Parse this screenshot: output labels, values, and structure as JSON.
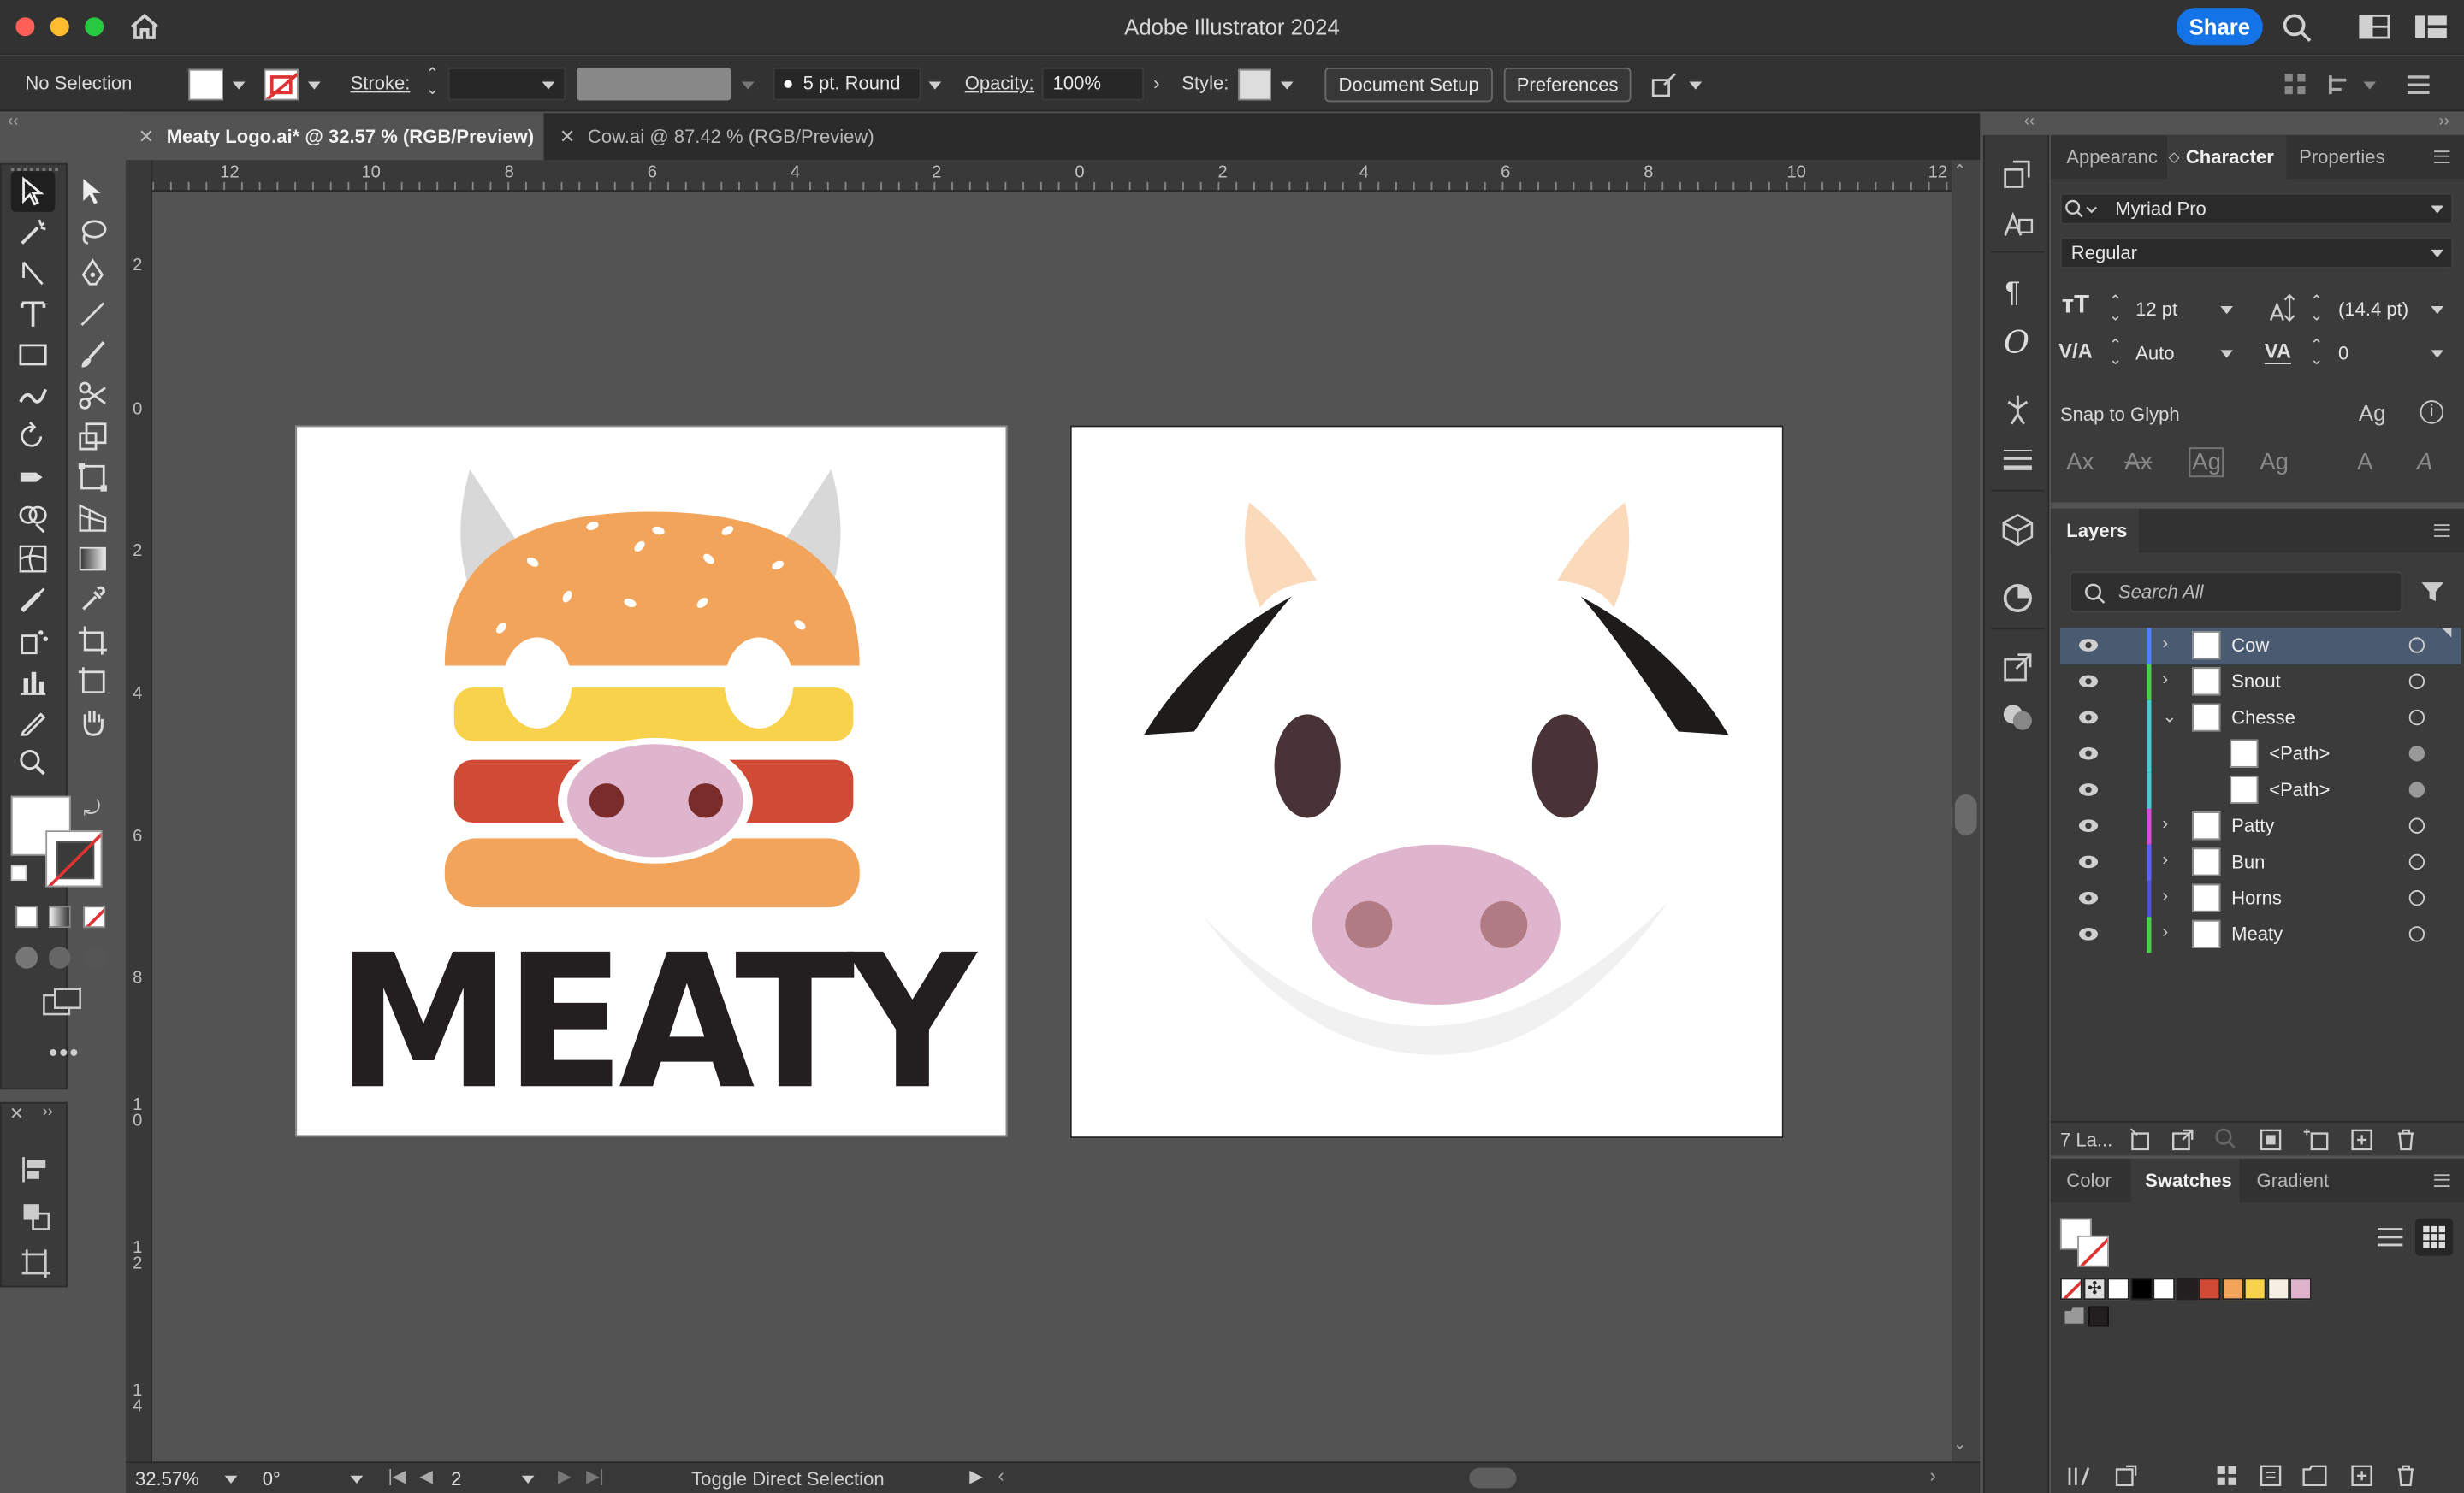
{
  "window": {
    "title": "Adobe Illustrator 2024",
    "share_label": "Share"
  },
  "control_bar": {
    "selection_status": "No Selection",
    "stroke_label": "Stroke:",
    "brush_label": "5 pt. Round",
    "opacity_label": "Opacity:",
    "opacity_value": "100%",
    "style_label": "Style:",
    "document_setup_label": "Document Setup",
    "preferences_label": "Preferences"
  },
  "documents": {
    "tabs": [
      {
        "label": "Meaty Logo.ai* @ 32.57 % (RGB/Preview)",
        "active": true
      },
      {
        "label": "Cow.ai @ 87.42 % (RGB/Preview)",
        "active": false
      }
    ]
  },
  "rulers": {
    "horizontal": [
      "12",
      "10",
      "8",
      "6",
      "4",
      "2",
      "0",
      "2",
      "4",
      "6",
      "8",
      "10",
      "12"
    ],
    "vertical": [
      "2",
      "0",
      "2",
      "4",
      "6",
      "8",
      "10",
      "12",
      "14"
    ]
  },
  "artwork": {
    "logo_text": "MEATY"
  },
  "status_bar": {
    "zoom": "32.57%",
    "rotation": "0°",
    "artboard_number": "2",
    "status_text": "Toggle Direct Selection"
  },
  "character_panel": {
    "tabs": [
      "Appearanc",
      "Character",
      "Properties"
    ],
    "font_family": "Myriad Pro",
    "font_style": "Regular",
    "font_size": "12 pt",
    "leading": "(14.4 pt)",
    "kerning": "Auto",
    "tracking": "0",
    "snap_to_glyph_label": "Snap to Glyph"
  },
  "layers_panel": {
    "title": "Layers",
    "search_placeholder": "Search All",
    "count_label": "7 La...",
    "rows": [
      {
        "name": "Cow",
        "color": "#4f7fff",
        "level": 0,
        "expand": "›",
        "selected": true
      },
      {
        "name": "Snout",
        "color": "#4fcc4f",
        "level": 0,
        "expand": "›",
        "selected": false
      },
      {
        "name": "Chesse",
        "color": "#3fd0d0",
        "level": 0,
        "expand": "⌄",
        "selected": false
      },
      {
        "name": "<Path>",
        "color": "#3fd0d0",
        "level": 1,
        "expand": "",
        "selected": false
      },
      {
        "name": "<Path>",
        "color": "#3fd0d0",
        "level": 1,
        "expand": "",
        "selected": false
      },
      {
        "name": "Patty",
        "color": "#d44fd4",
        "level": 0,
        "expand": "›",
        "selected": false
      },
      {
        "name": "Bun",
        "color": "#5f5fff",
        "level": 0,
        "expand": "›",
        "selected": false
      },
      {
        "name": "Horns",
        "color": "#4f4fd8",
        "level": 0,
        "expand": "›",
        "selected": false
      },
      {
        "name": "Meaty",
        "color": "#4fcc4f",
        "level": 0,
        "expand": "›",
        "selected": false
      }
    ]
  },
  "swatches_panel": {
    "tabs": [
      "Color",
      "Swatches",
      "Gradient"
    ],
    "swatches": [
      "#ffffff",
      "#000000",
      "#ffffff",
      "#231f20",
      "#d04a35",
      "#f2a45a",
      "#f7d24a",
      "#f5efe2",
      "#e0b3cd"
    ]
  },
  "colors": {
    "bun": "#f2a45a",
    "cheese": "#f7d24a",
    "patty": "#d04a35",
    "snout": "#dfb5ce",
    "nostril_logo": "#7a2c2a",
    "nostril_cow": "#b07b82",
    "horn_logo": "#d8d8d8",
    "horn_cow": "#fbd9bb",
    "eye": "#4a3336",
    "text": "#231f20",
    "accent": "#1473e6"
  }
}
